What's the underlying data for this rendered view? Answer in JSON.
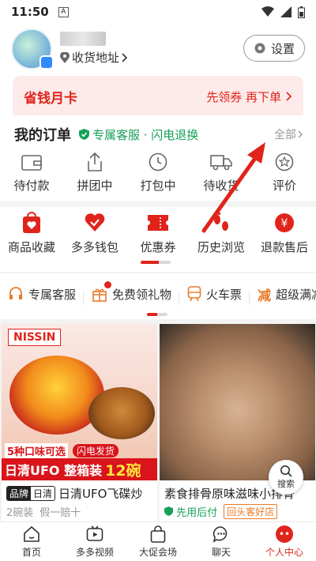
{
  "status_bar": {
    "time": "11:50",
    "a_icon": "A"
  },
  "profile": {
    "address_label": "收货地址",
    "settings_label": "设置"
  },
  "money_card": {
    "title": "省钱月卡",
    "link": "先领券 再下单"
  },
  "orders": {
    "title": "我的订单",
    "service_tag": "专属客服 · 闪电退换",
    "view_all": "全部",
    "items": [
      {
        "label": "待付款",
        "icon": "wallet-icon"
      },
      {
        "label": "拼团中",
        "icon": "share-icon"
      },
      {
        "label": "打包中",
        "icon": "clock-icon"
      },
      {
        "label": "待收货",
        "icon": "truck-icon"
      },
      {
        "label": "评价",
        "icon": "star-bubble-icon"
      }
    ]
  },
  "quick": {
    "items": [
      {
        "label": "商品收藏",
        "icon": "bag-heart-icon"
      },
      {
        "label": "多多钱包",
        "icon": "wallet-heart-icon"
      },
      {
        "label": "优惠券",
        "icon": "coupon-icon"
      },
      {
        "label": "历史浏览",
        "icon": "footprint-icon"
      },
      {
        "label": "退款售后",
        "icon": "refund-icon"
      }
    ]
  },
  "services": {
    "items": [
      {
        "label": "专属客服",
        "icon": "headset-icon"
      },
      {
        "label": "免费领礼物",
        "icon": "gift-icon"
      },
      {
        "label": "火车票",
        "icon": "train-icon"
      },
      {
        "label": "超级满减",
        "icon": "discount-icon"
      }
    ],
    "reduce_char": "减"
  },
  "products": [
    {
      "brand_tag_1": "品牌",
      "brand_tag_2": "日清",
      "title": "日清UFO飞碟炒",
      "meta_1": "2碗装",
      "meta_2": "假一赔十",
      "image_text": {
        "logo": "NISSIN",
        "strip_1": "5种口味可选",
        "strip_2": "闪电发货",
        "banner": "日清UFO 整箱装",
        "banner_big": "12碗"
      }
    },
    {
      "title": "素食排骨原味滋味小排骨",
      "meta_1": "先用后付",
      "meta_2": "回头客好店"
    }
  ],
  "search_float": {
    "label": "搜索"
  },
  "bottom_nav": [
    {
      "label": "首页",
      "icon": "home-icon"
    },
    {
      "label": "多多视频",
      "icon": "video-icon"
    },
    {
      "label": "大促会场",
      "icon": "shopping-bag-icon"
    },
    {
      "label": "聊天",
      "icon": "chat-icon"
    },
    {
      "label": "个人中心",
      "icon": "profile-icon",
      "active": true
    }
  ],
  "colors": {
    "brand_red": "#e0241b",
    "green": "#18a058"
  }
}
